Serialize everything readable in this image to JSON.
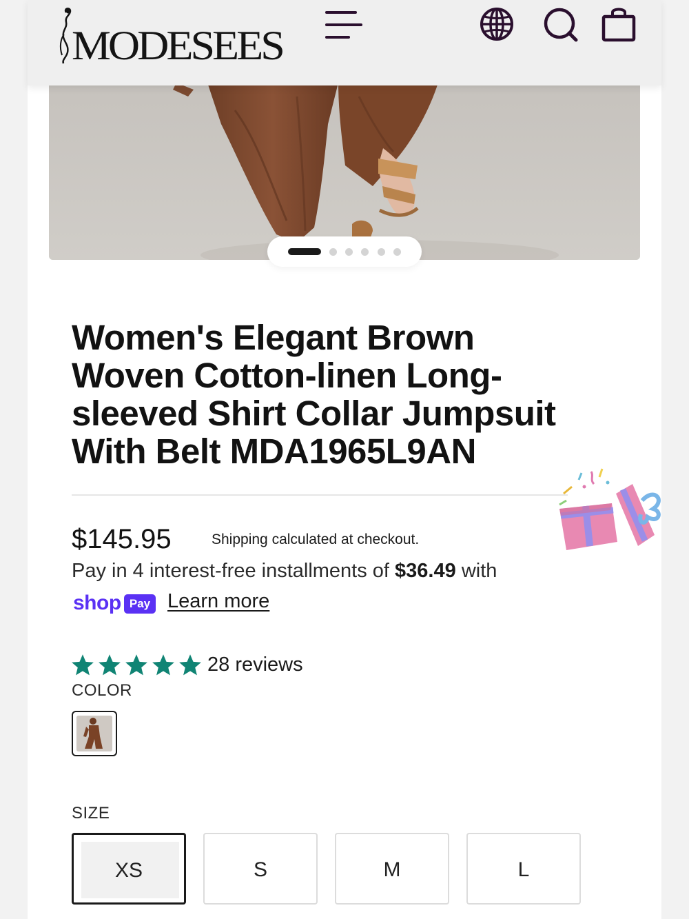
{
  "header": {
    "brand": "MODESEES",
    "icons": [
      "menu-icon",
      "globe-icon",
      "search-icon",
      "bag-icon"
    ]
  },
  "gallery": {
    "slide_count": 6,
    "active_index": 0
  },
  "product": {
    "title": "Women's Elegant Brown Woven Cotton-linen Long-sleeved Shirt Collar Jumpsuit With Belt MDA1965L9AN",
    "price": "$145.95",
    "shipping_note": "Shipping calculated at checkout.",
    "installments": {
      "prefix": "Pay in 4 interest-free installments of",
      "amount": "$36.49",
      "suffix": "with"
    },
    "shop_pay": {
      "brand": "shop",
      "badge": "Pay",
      "learn_more": "Learn more"
    },
    "rating": {
      "stars": 5,
      "reviews": "28 reviews",
      "star_color": "#108474"
    },
    "color": {
      "label": "COLOR",
      "selected": "brown"
    },
    "size": {
      "label": "SIZE",
      "options": [
        "XS",
        "S",
        "M",
        "L"
      ],
      "selected": "XS"
    }
  },
  "colors": {
    "brand_purple": "#5a31f4",
    "icon_dark": "#2a0f2e",
    "text": "#121212"
  }
}
